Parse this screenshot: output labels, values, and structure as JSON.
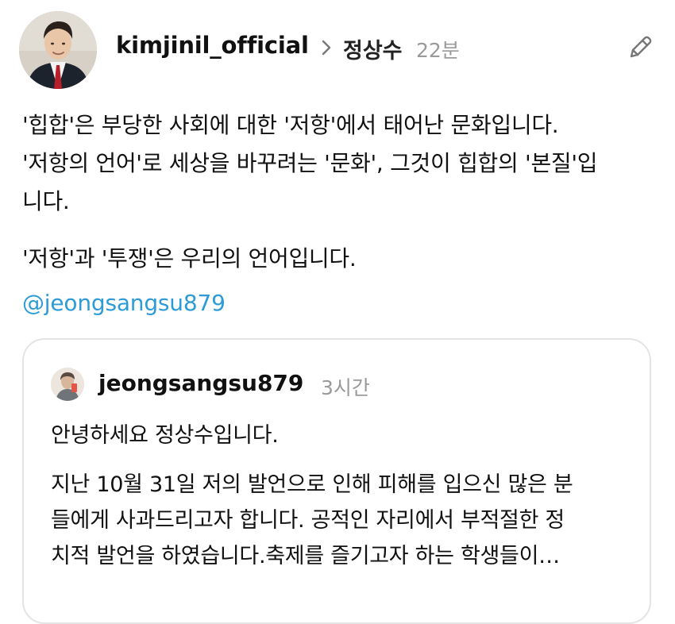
{
  "header": {
    "username": "kimjinil_official",
    "reply_to": "정상수",
    "time": "22분"
  },
  "post": {
    "paragraph1": [
      "'힙합'은 부당한 사회에 대한 '저항'에서 태어난 문화입니다.",
      "'저항의 언어'로 세상을 바꾸려는 '문화', 그것이 힙합의 '본질'입",
      "니다."
    ],
    "paragraph2": "'저항'과 '투쟁'은 우리의 언어입니다.",
    "mention": "@jeongsangsu879"
  },
  "quoted_post": {
    "username": "jeongsangsu879",
    "time": "3시간",
    "greeting": "안녕하세요 정상수입니다.",
    "body_lines": [
      "지난 10월 31일 저의 발언으로 인해 피해를 입으신 많은 분",
      "들에게 사과드리고자 합니다. 공적인 자리에서 부적절한 정",
      "치적 발언을 하였습니다.축제를 즐기고자 하는 학생들이…"
    ]
  },
  "colors": {
    "mention": "#2d9bd8",
    "muted": "#9a9a9a",
    "card_border": "#e4e4e4"
  },
  "icons": {
    "reply": "chevron-right-icon",
    "edit": "pencil-icon"
  }
}
